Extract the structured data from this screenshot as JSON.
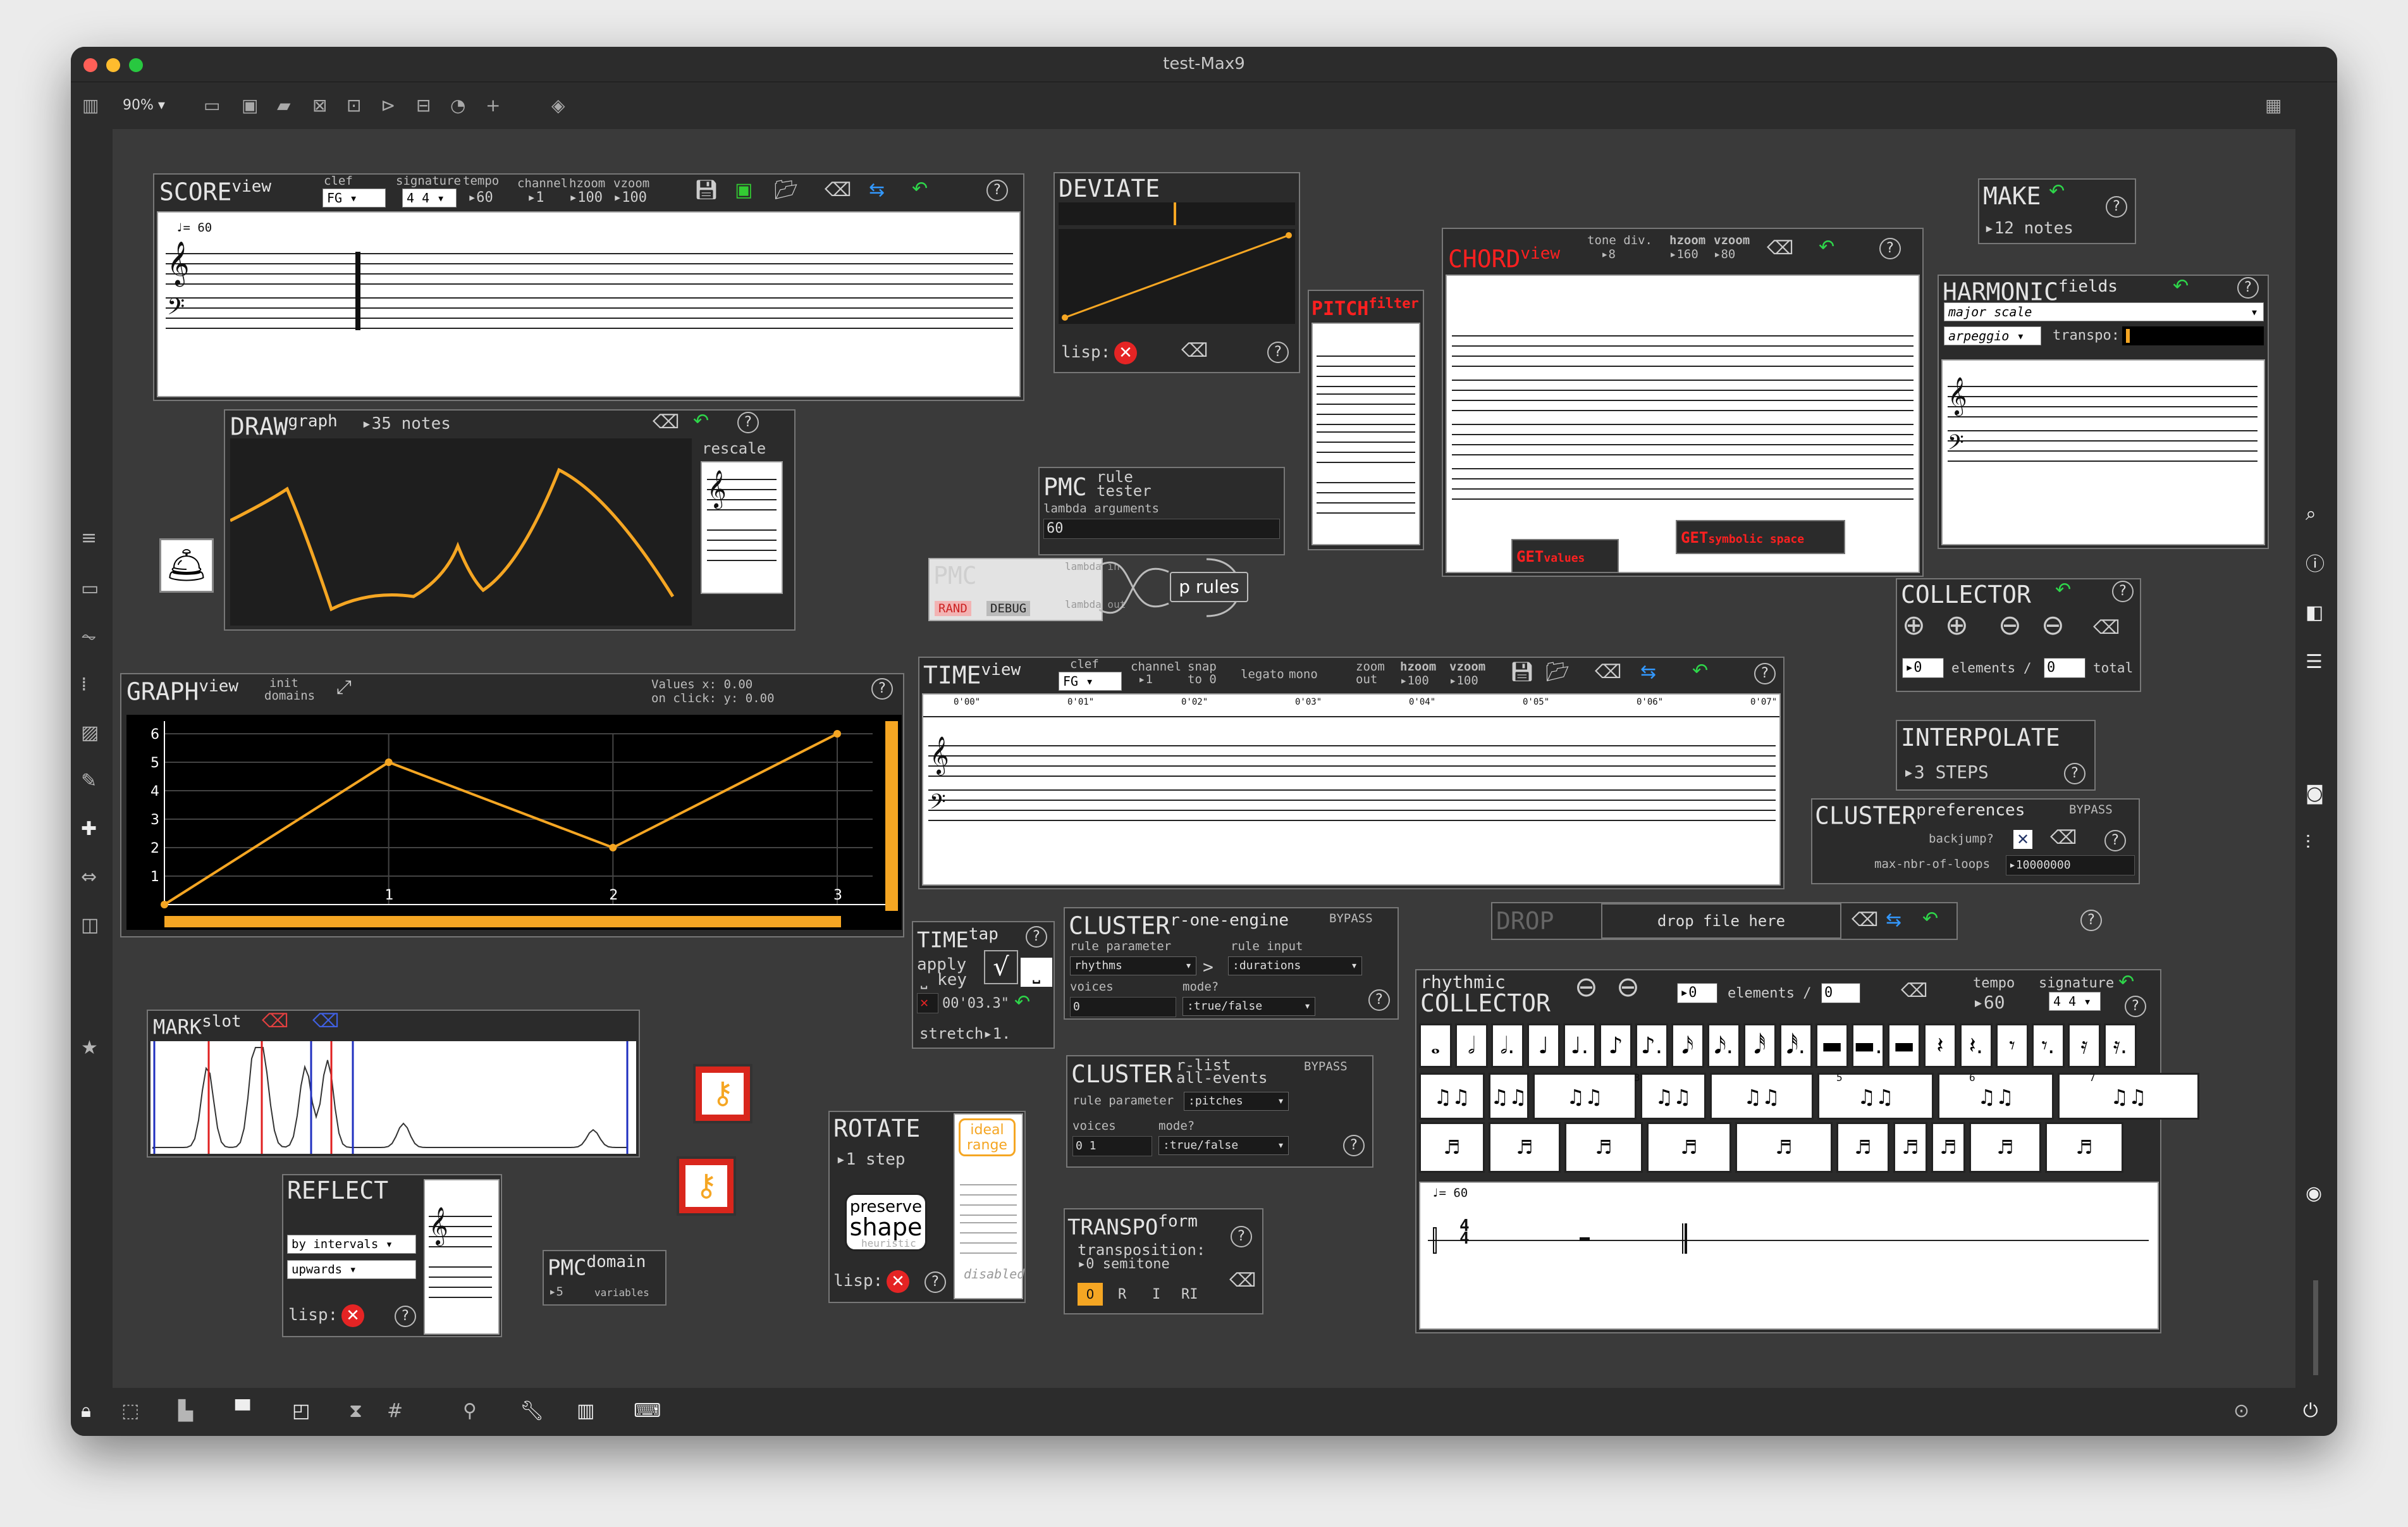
{
  "window": {
    "title": "test-Max9",
    "zoom": "90%"
  },
  "score": {
    "title": "SCORE",
    "sup": "view",
    "clef_lbl": "clef",
    "clef": "FG",
    "sig_lbl": "signature",
    "sig": "4 4",
    "tempo_lbl": "tempo",
    "tempo": "60",
    "channel_lbl": "channel",
    "channel": "1",
    "hzoom_lbl": "hzoom",
    "hzoom": "100",
    "vzoom_lbl": "vzoom",
    "vzoom": "100",
    "tempo_mark": "= 60"
  },
  "draw": {
    "title": "DRAW",
    "sup": "graph",
    "count": "35",
    "notes": "notes",
    "rescale": "rescale"
  },
  "graph": {
    "title": "GRAPH",
    "sup": "view",
    "init": "init",
    "domains": "domains",
    "values": "Values",
    "on_click": "on click:",
    "x_label": "x:",
    "x_val": "0.00",
    "y_label": "y:",
    "y_val": "0.00",
    "yticks": [
      "6",
      "5",
      "4",
      "3",
      "2",
      "1"
    ],
    "xticks": [
      "1",
      "2",
      "3"
    ]
  },
  "mark": {
    "title": "MARK",
    "sup": "slot"
  },
  "reflect": {
    "title": "REFLECT",
    "dd1": "by intervals",
    "dd2": "upwards",
    "lisp": "lisp:"
  },
  "pmcdomain": {
    "title": "PMC",
    "sup": "domain",
    "count": "5",
    "variables": "variables"
  },
  "deviate": {
    "title": "DEVIATE",
    "lisp": "lisp:"
  },
  "pmcrule": {
    "title": "PMC",
    "sup1": "rule",
    "sup2": "tester",
    "lambda": "lambda arguments",
    "value": "60"
  },
  "pmcsolver": {
    "title": "PMC",
    "rand": "RAND",
    "debug": "DEBUG",
    "lambda_in": "lambda in",
    "lambda_out": "lambda out",
    "prules": "p rules"
  },
  "pitchfilter": {
    "title": "PITCH",
    "sup": "filter"
  },
  "chord": {
    "title": "CHORD",
    "sup": "view",
    "tone_lbl": "tone div.",
    "tone": "8",
    "hzoom_lbl": "hzoom",
    "hzoom": "160",
    "vzoom_lbl": "vzoom",
    "vzoom": "80"
  },
  "getvalues": {
    "a": "GET",
    "b": "values"
  },
  "getsym": {
    "a": "GET",
    "b": "symbolic space"
  },
  "make": {
    "title": "MAKE",
    "count": "12",
    "notes": "notes"
  },
  "harmonic": {
    "title": "HARMONIC",
    "sup": "fields",
    "scale": "major scale",
    "mode": "arpeggio",
    "transpo": "transpo:"
  },
  "collector": {
    "title": "COLLECTOR",
    "elements_val": "0",
    "elements": "elements",
    "slash": "/",
    "total_val": "0",
    "total": "total"
  },
  "interpolate": {
    "title": "INTERPOLATE",
    "steps_val": "3",
    "steps": "STEPS"
  },
  "clusterprefs": {
    "title": "CLUSTER",
    "sup": "preferences",
    "bypass": "BYPASS",
    "backjump": "backjump?",
    "maxloops": "max-nbr-of-loops",
    "maxloops_val": "10000000"
  },
  "time": {
    "title": "TIME",
    "sup": "view",
    "clef_lbl": "clef",
    "clef": "FG",
    "channel_lbl": "channel",
    "channel": "1",
    "snap": "snap to 0",
    "legato": "legato",
    "mono": "mono",
    "zoomout": "zoom out",
    "hzoom_lbl": "hzoom",
    "hzoom": "100",
    "vzoom_lbl": "vzoom",
    "vzoom": "100",
    "ruler": [
      "0'00\"",
      "0'01\"",
      "0'02\"",
      "0'03\"",
      "0'04\"",
      "0'05\"",
      "0'06\"",
      "0'07\""
    ]
  },
  "drop": {
    "title": "DROP",
    "drop_text": "drop file here"
  },
  "timetap": {
    "title": "TIME",
    "sup": "tap",
    "apply": "apply",
    "key": "key",
    "time": "00'03.3\"",
    "stretch": "stretch",
    "stretch_val": "1."
  },
  "clusterone": {
    "title": "CLUSTER",
    "sup": "r-one-engine",
    "bypass": "BYPASS",
    "rule_param": "rule parameter",
    "rule_input": "rule input",
    "rhythms": "rhythms",
    "durations": ":durations",
    "voices": "voices",
    "voices_val": "0",
    "mode": "mode?",
    "mode_val": ":true/false"
  },
  "clusterlist": {
    "title": "CLUSTER",
    "sup1": "r-list",
    "sup2": "all-events",
    "bypass": "BYPASS",
    "rule_param": "rule parameter",
    "pitches": ":pitches",
    "voices": "voices",
    "voices_val": "0 1",
    "mode": "mode?",
    "mode_val": ":true/false"
  },
  "rotate": {
    "title": "ROTATE",
    "step_val": "1",
    "step": "step",
    "ideal": "ideal range",
    "preserve1": "preserve",
    "preserve2": "shape",
    "heuristic": "heuristic",
    "disabled": "disabled",
    "lisp": "lisp:"
  },
  "transpo": {
    "title": "TRANSPO",
    "sup": "form",
    "line1": "transposition:",
    "val": "0",
    "unit": "semitone",
    "btns": [
      "0",
      "R",
      "I",
      "RI"
    ]
  },
  "rhythmic": {
    "title1": "rhythmic",
    "title2": "COLLECTOR",
    "elements_val": "0",
    "elements": "elements",
    "slash": "/",
    "total_val": "0",
    "tempo_lbl": "tempo",
    "tempo": "60",
    "sig_lbl": "signature",
    "sig": "4 4",
    "tuplets": [
      "3",
      "5",
      "6",
      "7"
    ],
    "tempo_mark": "= 60"
  },
  "colors": {
    "accent": "#f5a623",
    "green": "#2ed64a",
    "red": "#e52424",
    "bg": "#3a3a3a"
  },
  "icons": [
    "sidebar-icon",
    "save-icon",
    "folder-icon",
    "eraser-icon",
    "undo-arrow-icon",
    "help-icon",
    "bell-icon",
    "key-icon",
    "search-icon",
    "info-icon",
    "camera-icon",
    "lock-icon",
    "power-icon"
  ]
}
